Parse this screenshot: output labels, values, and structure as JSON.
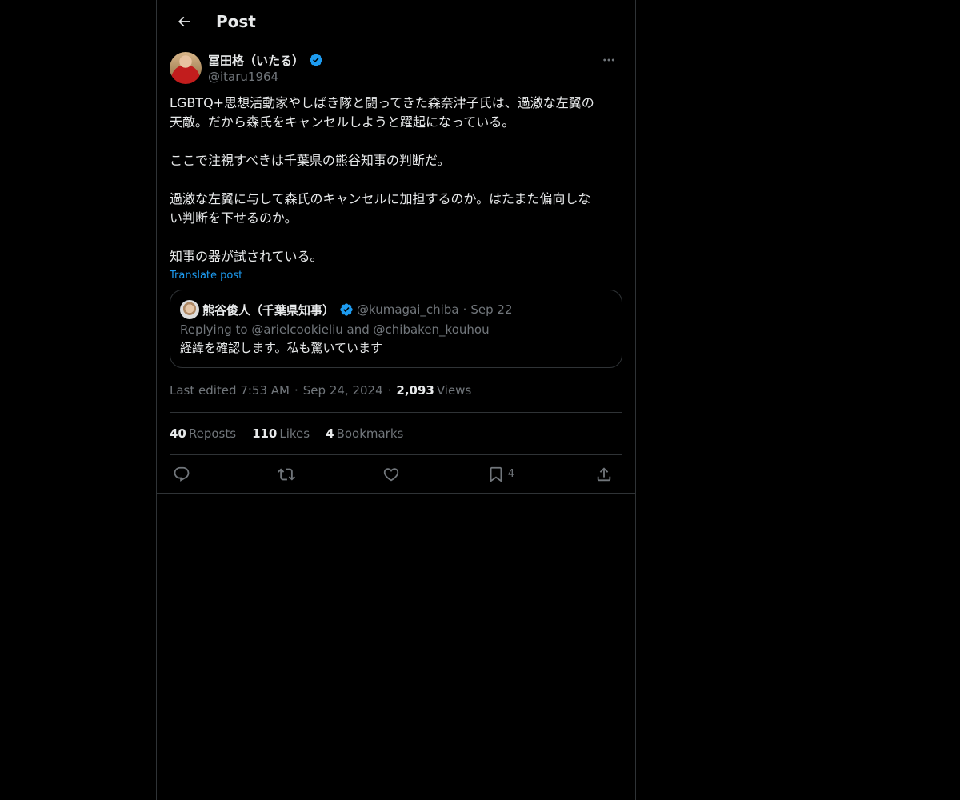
{
  "header": {
    "title": "Post"
  },
  "post": {
    "author_name": "冨田格（いたる）",
    "author_handle": "@itaru1964",
    "lines": [
      "LGBTQ+思想活動家やしばき隊と闘ってきた森奈津子氏は、過激な左翼の",
      "天敵。だから森氏をキャンセルしようと躍起になっている。",
      "",
      "ここで注視すべきは千葉県の熊谷知事の判断だ。",
      "",
      "過激な左翼に与して森氏のキャンセルに加担するのか。はたまた偏向しな",
      "い判断を下せるのか。",
      "",
      "知事の器が試されている。"
    ],
    "translate_label": "Translate post"
  },
  "quote": {
    "name": "熊谷俊人（千葉県知事）",
    "handle": "@kumagai_chiba",
    "dot": "·",
    "date": "Sep 22",
    "reply": "Replying to @arielcookieliu and @chibaken_kouhou",
    "text": "経緯を確認します。私も驚いています"
  },
  "meta": {
    "edited": "Last edited 7:53 AM",
    "sep": "·",
    "date": "Sep 24, 2024",
    "views_count": "2,093",
    "views_label": "Views"
  },
  "stats": {
    "reposts_count": "40",
    "reposts_label": "Reposts",
    "likes_count": "110",
    "likes_label": "Likes",
    "bookmarks_count": "4",
    "bookmarks_label": "Bookmarks"
  },
  "actions": {
    "bookmark_count": "4"
  },
  "colors": {
    "accent": "#1d9bf0",
    "muted": "#71767b",
    "border": "#2f3336",
    "text": "#e7e9ea",
    "background": "#000000"
  },
  "icons": [
    "back-arrow-icon",
    "verified-icon",
    "more-icon",
    "reply-icon",
    "repost-icon",
    "like-icon",
    "bookmark-icon",
    "share-icon"
  ]
}
